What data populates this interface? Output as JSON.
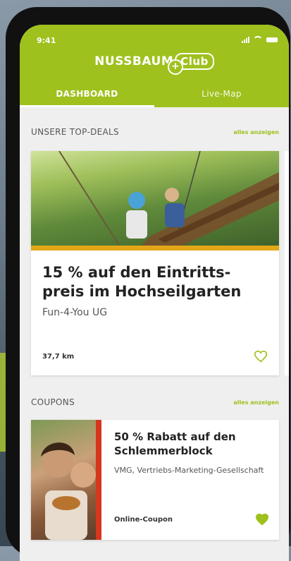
{
  "status_bar": {
    "time": "9:41"
  },
  "brand": {
    "name": "NUSSBAUM",
    "club": "Club",
    "plus": "+"
  },
  "tabs": [
    {
      "label": "DASHBOARD",
      "active": true
    },
    {
      "label": "Live-Map",
      "active": false
    }
  ],
  "top_deals": {
    "title": "UNSERE TOP-DEALS",
    "see_all": "alles anzeigen",
    "card": {
      "title": "15 % auf den Eintritts-preis im Hochseilgarten",
      "company": "Fun-4-You UG",
      "distance": "37,7 km",
      "favorite": false
    }
  },
  "coupons": {
    "title": "COUPONS",
    "see_all": "alles anzeigen",
    "card": {
      "title": "50 % Rabatt auf den Schlemmerblock",
      "company": "VMG, Vertriebs-Marketing-Gesellschaft",
      "type": "Online-Coupon",
      "favorite": true
    }
  },
  "colors": {
    "brand_green": "#9ec11d",
    "deal_strip": "#e3a718",
    "coupon_bar": "#d6361f"
  },
  "icons": {
    "heart": "heart-icon"
  }
}
